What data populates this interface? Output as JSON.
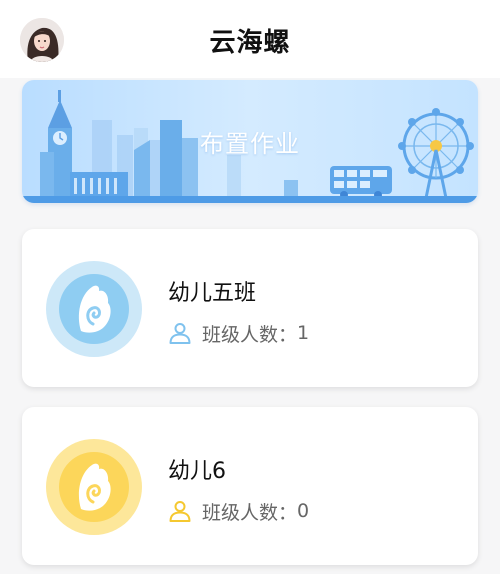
{
  "header": {
    "title": "云海螺"
  },
  "banner": {
    "label": "布置作业"
  },
  "classes": [
    {
      "name": "幼儿五班",
      "member_label": "班级人数：",
      "member_count": "1",
      "accent": "#7fc2ee",
      "badge_bg": "#cde8f8"
    },
    {
      "name": "幼儿6",
      "member_label": "班级人数：",
      "member_count": "0",
      "accent": "#f5c830",
      "badge_bg": "#fde79a"
    }
  ],
  "colors": {
    "page_bg": "#f6f6f7",
    "banner_blue": "#5fa8ee"
  },
  "icons": {
    "avatar": "user-avatar",
    "class_badge": "seashell-icon",
    "members": "person-icon",
    "banner_art": "city-skyline-illustration"
  }
}
